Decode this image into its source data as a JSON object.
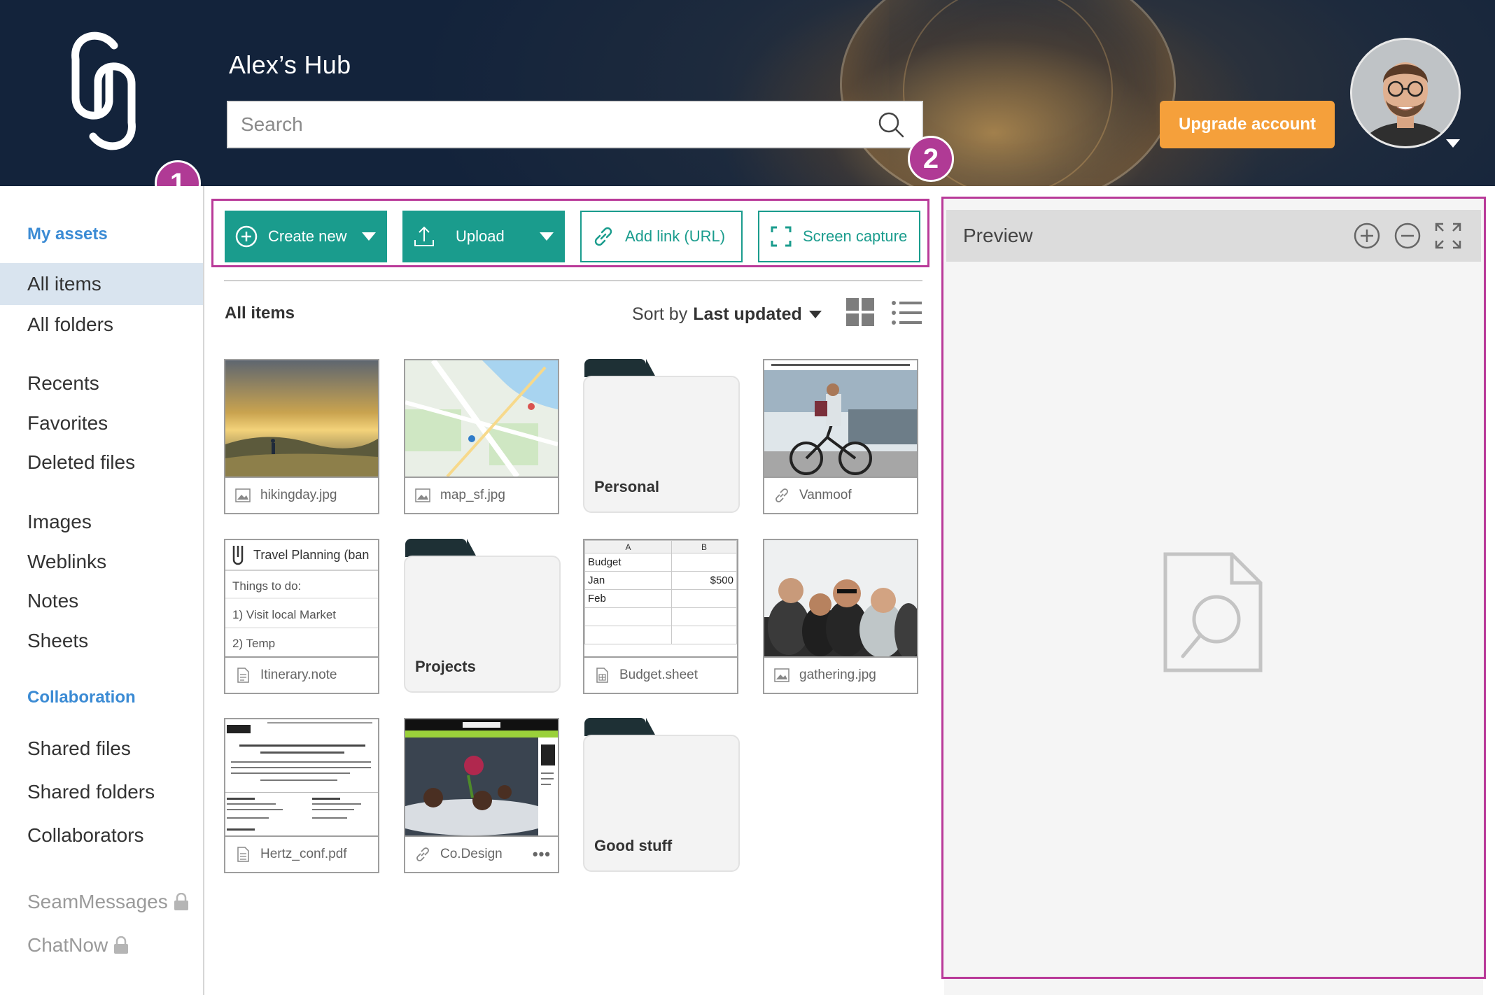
{
  "header": {
    "title": "Alex’s Hub",
    "search_placeholder": "Search",
    "upgrade_label": "Upgrade account"
  },
  "badges": [
    "1",
    "2"
  ],
  "sidebar": {
    "my_assets_label": "My assets",
    "items": [
      {
        "label": "All items",
        "active": true
      },
      {
        "label": "All folders"
      },
      {
        "label": "Recents"
      },
      {
        "label": "Favorites"
      },
      {
        "label": "Deleted files"
      },
      {
        "label": "Images"
      },
      {
        "label": "Weblinks"
      },
      {
        "label": "Notes"
      },
      {
        "label": "Sheets"
      }
    ],
    "collaboration_label": "Collaboration",
    "collab_items": [
      {
        "label": "Shared files"
      },
      {
        "label": "Shared folders"
      },
      {
        "label": "Collaborators"
      }
    ],
    "locked_items": [
      {
        "label": "SeamMessages"
      },
      {
        "label": "ChatNow"
      }
    ]
  },
  "toolbar": {
    "create_new": "Create new",
    "upload": "Upload",
    "add_link": "Add link (URL)",
    "screen_capture": "Screen capture"
  },
  "list": {
    "title": "All items",
    "sort_prefix": "Sort by",
    "sort_value": "Last updated"
  },
  "files": [
    {
      "name": "hikingday.jpg",
      "type": "image"
    },
    {
      "name": "map_sf.jpg",
      "type": "image"
    },
    {
      "name": "Personal",
      "type": "folder"
    },
    {
      "name": "Vanmoof",
      "type": "weblink"
    },
    {
      "name": "Itinerary.note",
      "type": "note"
    },
    {
      "name": "Projects",
      "type": "folder"
    },
    {
      "name": "Budget.sheet",
      "type": "sheet"
    },
    {
      "name": "gathering.jpg",
      "type": "image"
    },
    {
      "name": "Hertz_conf.pdf",
      "type": "document"
    },
    {
      "name": "Co.Design",
      "type": "weblink"
    },
    {
      "name": "Good stuff",
      "type": "folder"
    }
  ],
  "note_preview": {
    "title": "Travel Planning (ban",
    "lines": [
      "Things to do:",
      "1) Visit local Market",
      "2) Temp"
    ]
  },
  "sheet_preview": {
    "columns": [
      "A",
      "B"
    ],
    "rows": [
      [
        "Budget",
        ""
      ],
      [
        "Jan",
        "$500"
      ],
      [
        "Feb",
        ""
      ],
      [
        "",
        ""
      ],
      [
        "",
        ""
      ]
    ]
  },
  "preview": {
    "title": "Preview"
  },
  "colors": {
    "accent_teal": "#1a9c8d",
    "highlight_magenta": "#b93a99",
    "upgrade_orange": "#f5a03b",
    "link_blue": "#3b8bd4"
  },
  "icons": [
    "logo-icon",
    "search-icon",
    "plus-circle-icon",
    "upload-icon",
    "link-icon",
    "screen-capture-icon",
    "grid-view-icon",
    "list-view-icon",
    "image-icon",
    "note-icon",
    "sheet-icon",
    "document-icon",
    "lock-icon",
    "zoom-in-icon",
    "zoom-out-icon",
    "fullscreen-icon",
    "document-search-icon"
  ]
}
